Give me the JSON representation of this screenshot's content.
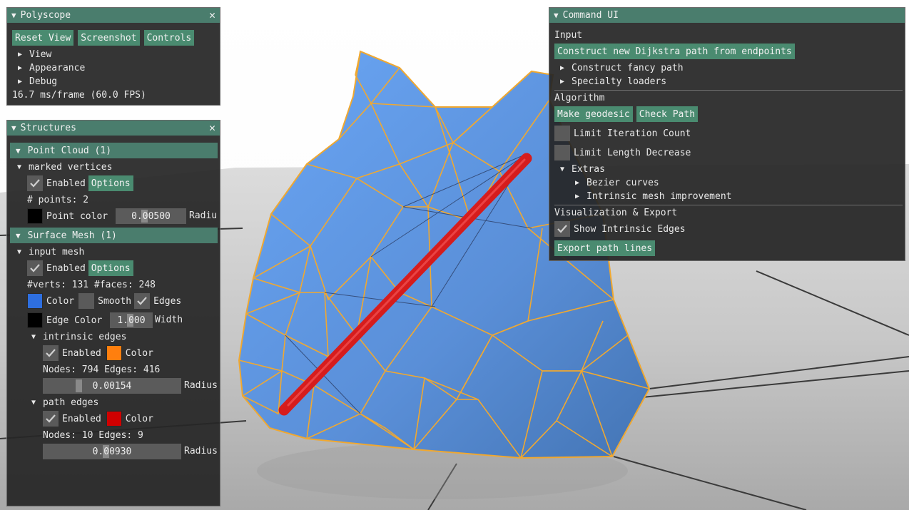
{
  "polyscope_window": {
    "title": "Polyscope",
    "buttons": [
      "Reset View",
      "Screenshot",
      "Controls"
    ],
    "tree": [
      "View",
      "Appearance",
      "Debug"
    ],
    "fps": "16.7 ms/frame (60.0 FPS)"
  },
  "structures_window": {
    "title": "Structures",
    "point_cloud": {
      "header": "Point Cloud (1)",
      "name": "marked vertices",
      "enabled_label": "Enabled",
      "options_label": "Options",
      "points_label": "# points: 2",
      "color_label": "Point color",
      "color": "#000000",
      "radius_value": "0.00500",
      "radius_label": "Radiu"
    },
    "surface_mesh": {
      "header": "Surface Mesh (1)",
      "name": "input mesh",
      "enabled_label": "Enabled",
      "options_label": "Options",
      "stats": "#verts: 131  #faces: 248",
      "color_label": "Color",
      "color": "#2e6fe0",
      "smooth_label": "Smooth",
      "edges_label": "Edges",
      "edge_color_label": "Edge Color",
      "edge_color": "#000000",
      "width_value": "1.000",
      "width_label": "Width",
      "intrinsic_edges": {
        "name": "intrinsic edges",
        "enabled_label": "Enabled",
        "color_label": "Color",
        "color": "#ff7f0e",
        "stats": "Nodes: 794  Edges: 416",
        "radius_value": "0.00154",
        "radius_label": "Radius"
      },
      "path_edges": {
        "name": "path edges",
        "enabled_label": "Enabled",
        "color_label": "Color",
        "color": "#d00000",
        "stats": "Nodes: 10  Edges: 9",
        "radius_value": "0.00930",
        "radius_label": "Radius"
      }
    }
  },
  "command_window": {
    "title": "Command UI",
    "input_section": "Input",
    "construct_button": "Construct new Dijkstra path from endpoints",
    "fancy_path": "Construct fancy path",
    "specialty_loaders": "Specialty loaders",
    "algorithm_section": "Algorithm",
    "make_geodesic_button": "Make geodesic",
    "check_path_button": "Check Path",
    "limit_iteration": "Limit Iteration Count",
    "limit_length": "Limit Length Decrease",
    "extras": "Extras",
    "bezier": "Bezier curves",
    "intrinsic_improve": "Intrinsic mesh improvement",
    "viz_section": "Visualization & Export",
    "show_intrinsic": "Show Intrinsic Edges",
    "export_button": "Export path lines"
  },
  "colors": {
    "accent": "#4a8b70",
    "title_bar": "#4a7d6d",
    "mesh_face": "#5f95dd",
    "mesh_edge": "#f0a830",
    "path": "#d62020"
  }
}
